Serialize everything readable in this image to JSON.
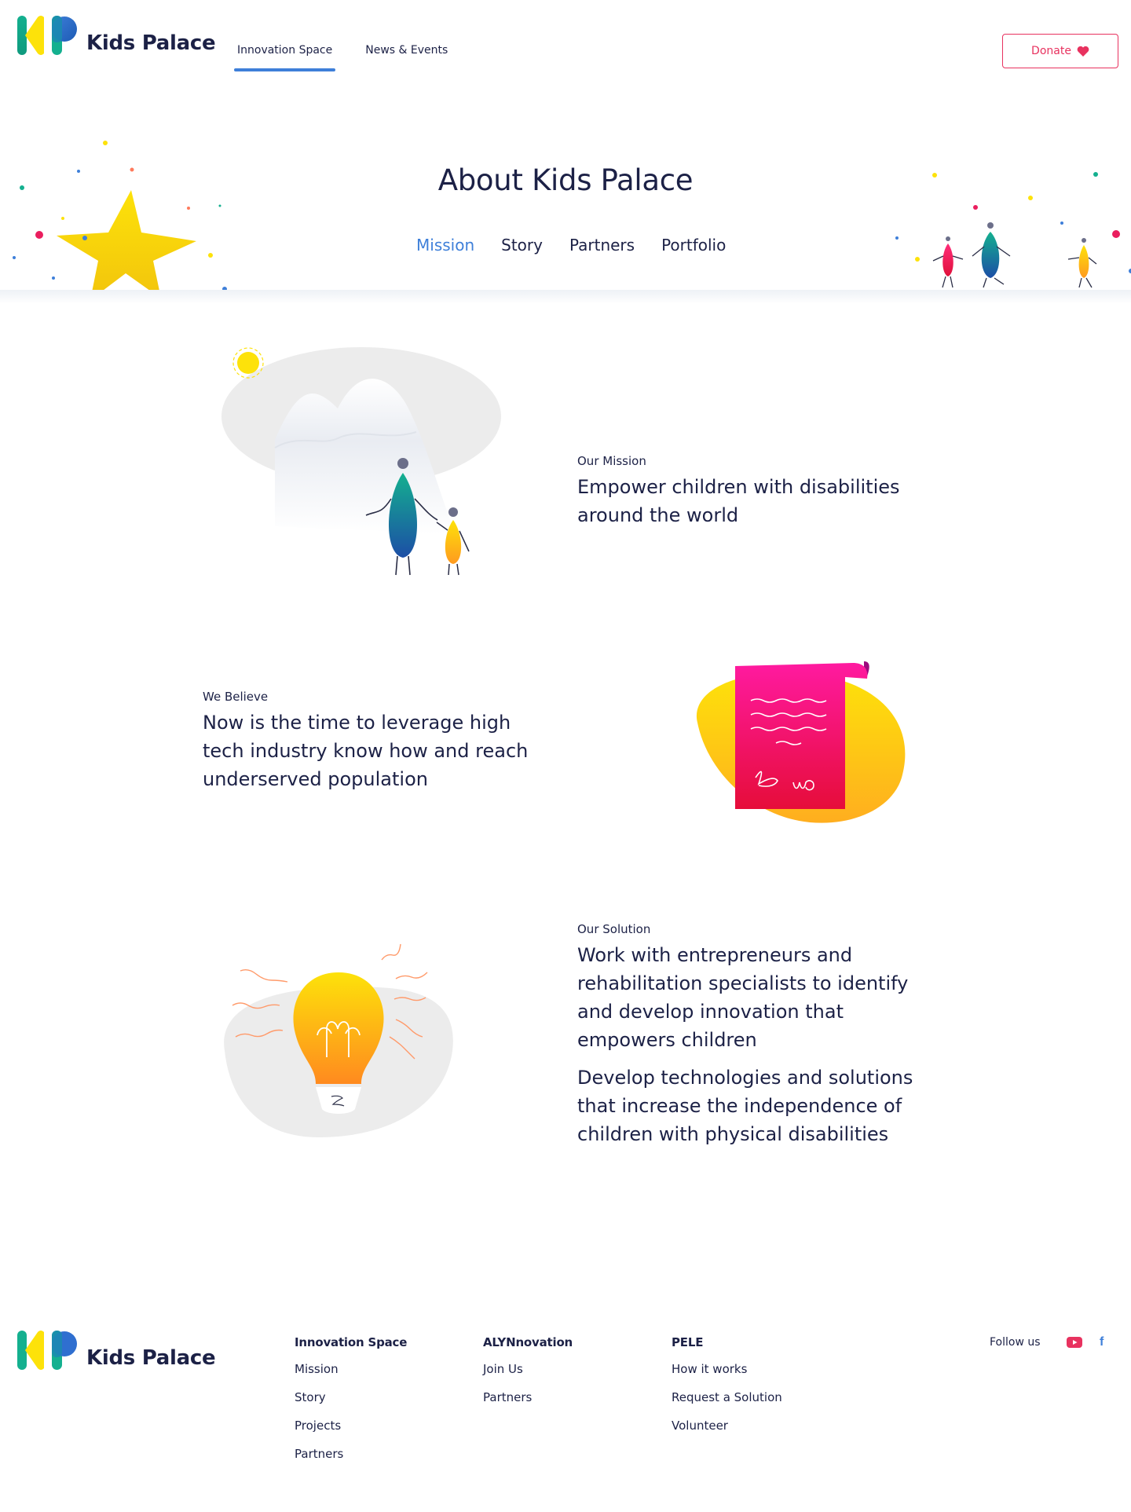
{
  "brand": {
    "name": "Kids Palace"
  },
  "nav": {
    "items": [
      {
        "label": "Innovation Space",
        "active": true
      },
      {
        "label": "News & Events",
        "active": false
      }
    ],
    "donate_label": "Donate"
  },
  "hero": {
    "title": "About Kids Palace",
    "tabs": [
      {
        "label": "Mission",
        "active": true
      },
      {
        "label": "Story",
        "active": false
      },
      {
        "label": "Partners",
        "active": false
      },
      {
        "label": "Portfolio",
        "active": false
      }
    ]
  },
  "sections": {
    "mission": {
      "eyebrow": "Our Mission",
      "statement": "Empower children with disabilities around the world"
    },
    "believe": {
      "eyebrow": "We Believe",
      "statement": "Now is the time to leverage high tech industry know how and reach underserved population"
    },
    "solution": {
      "eyebrow": "Our Solution",
      "statement_1": "Work with entrepreneurs and rehabilitation specialists to identify and develop innovation that empowers children",
      "statement_2": "Develop technologies and solutions that increase the independence of children with physical disabilities"
    }
  },
  "footer": {
    "columns": [
      {
        "heading": "Innovation Space",
        "links": [
          "Mission",
          "Story",
          "Projects",
          "Partners"
        ]
      },
      {
        "heading": "ALYNnovation",
        "links": [
          "Join Us",
          "Partners"
        ]
      },
      {
        "heading": "PELE",
        "links": [
          "How it works",
          "Request a Solution",
          "Volunteer"
        ]
      }
    ],
    "follow_label": "Follow us",
    "social": [
      "youtube-icon",
      "facebook-icon"
    ],
    "facebook_glyph": "f"
  },
  "colors": {
    "navy": "#1c2146",
    "accent_blue": "#3e7fd9",
    "donate_pink": "#e8325f",
    "yellow": "#fde20a",
    "teal": "#14b08f"
  }
}
